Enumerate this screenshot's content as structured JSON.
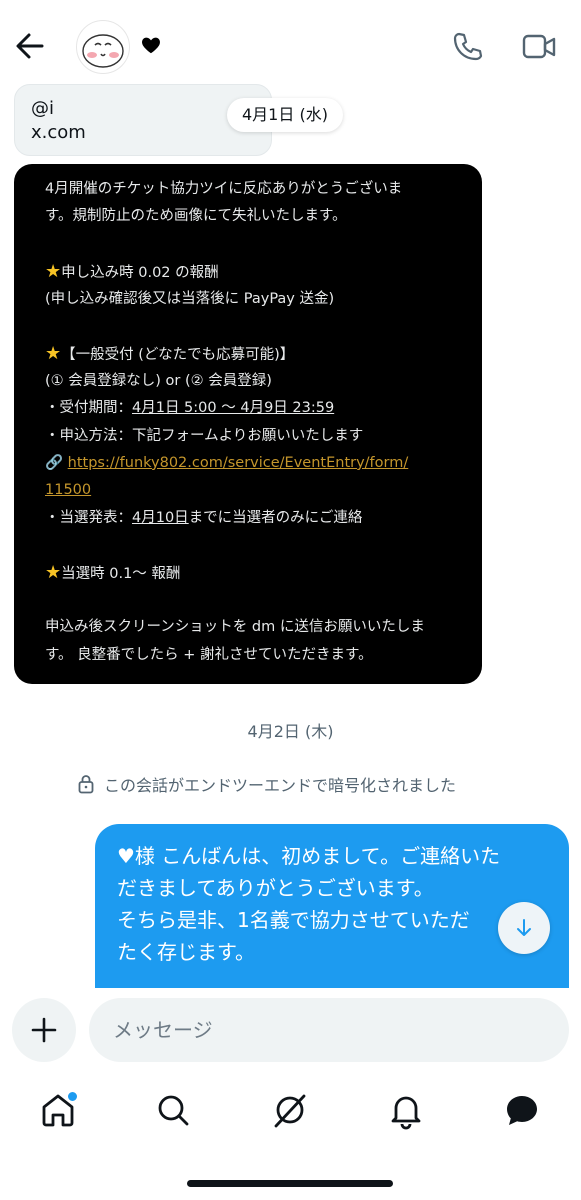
{
  "header": {
    "back_icon": "arrow-left-icon",
    "avatar_icon": "user-avatar",
    "badge_icon": "heart-icon",
    "call_icon": "phone-icon",
    "video_icon": "video-icon"
  },
  "link_preview": {
    "handle": "@i",
    "domain": "x.com"
  },
  "date_pill": "4月1日 (水)",
  "dark_message": {
    "lines": [
      "4月開催のチケット協力ツイに反応ありがとうございま",
      "す。規制防止のため画像にて失礼いたします。",
      "",
      "申し込み時 0.02 の報酬",
      "(申し込み確認後又は当落後に PayPay 送金)",
      "",
      "【一般受付 (どなたでも応募可能)】",
      "(① 会員登録なし) or (② 会員登録)",
      "・受付期間：",
      "4月1日 5:00 〜 4月9日 23:59",
      "・申込方法：下記フォームよりお願いいたします",
      "https://funky802.com/service/EventEntry/form/",
      "11500",
      "・当選発表：",
      "4月10日",
      "までに当選者のみにご連絡",
      "当選時 0.1〜 報酬",
      "申込み後スクリーンショットを dm に送信お願いいたしま",
      "す。 良整番でしたら + 謝礼させていただきます。"
    ]
  },
  "date2": "4月2日 (木)",
  "e2e_text": "この会話がエンドツーエンドで暗号化されました",
  "blue_message": {
    "lines": [
      "♥様 こんばんは、初めまして。ご連絡いた",
      "だきましてありがとうございます。",
      "そちら是非、1名義で協力させていただ",
      "たく存じます。"
    ]
  },
  "composer": {
    "placeholder": "メッセージ",
    "value": ""
  },
  "nav": [
    "home-icon",
    "search-icon",
    "grok-icon",
    "bell-icon",
    "messages-icon"
  ],
  "colors": {
    "accent": "#1d9bf0",
    "link": "#c4962c",
    "star": "#f7c325"
  }
}
